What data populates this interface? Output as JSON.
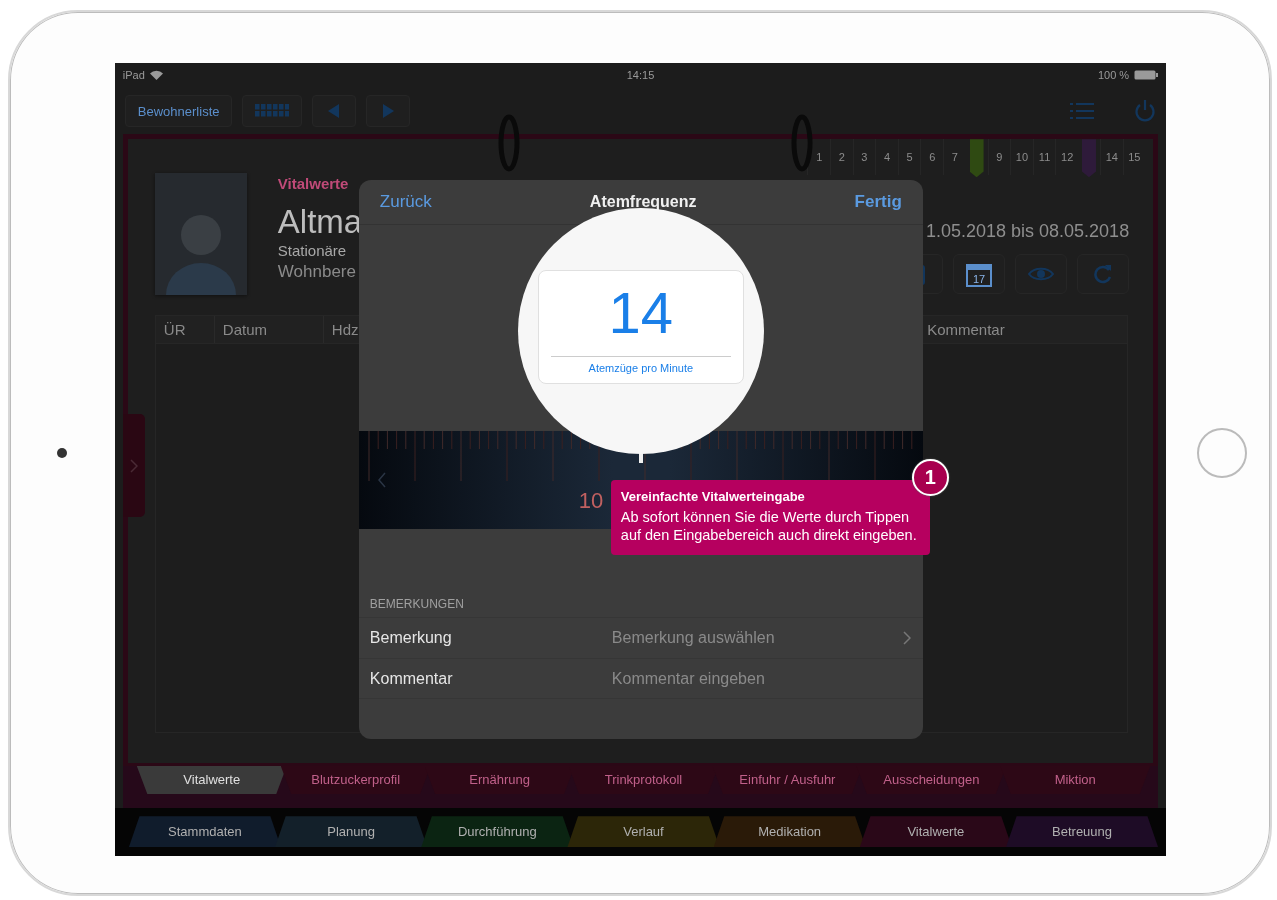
{
  "status_bar": {
    "device": "iPad",
    "time": "14:15",
    "battery": "100 %"
  },
  "toolbar": {
    "left_buttons": [
      {
        "kind": "text",
        "label": "Bewohnerliste"
      },
      {
        "kind": "grid"
      },
      {
        "kind": "prev"
      },
      {
        "kind": "next"
      }
    ],
    "right_buttons": [
      {
        "kind": "list"
      },
      {
        "kind": "power"
      }
    ]
  },
  "day_tabs": [
    {
      "kind": "number",
      "label": "1"
    },
    {
      "kind": "number",
      "label": "2"
    },
    {
      "kind": "number",
      "label": "3"
    },
    {
      "kind": "number",
      "label": "4"
    },
    {
      "kind": "number",
      "label": "5"
    },
    {
      "kind": "number",
      "label": "6"
    },
    {
      "kind": "number",
      "label": "7"
    },
    {
      "kind": "bookmark",
      "color": "#2f4a12"
    },
    {
      "kind": "number",
      "label": "9"
    },
    {
      "kind": "number",
      "label": "10"
    },
    {
      "kind": "number",
      "label": "11"
    },
    {
      "kind": "number",
      "label": "12"
    },
    {
      "kind": "bookmark",
      "color": "#2e1a3a"
    },
    {
      "kind": "number",
      "label": "14"
    },
    {
      "kind": "number",
      "label": "15"
    }
  ],
  "patient": {
    "section": "Vitalwerte",
    "name": "Altma",
    "care_type": "Stationäre",
    "area": "Wohnbere",
    "period": "1.05.2018 bis 08.05.2018"
  },
  "actions": [
    {
      "kind": "clipboard"
    },
    {
      "kind": "calendar",
      "label": "17"
    },
    {
      "kind": "eye"
    },
    {
      "kind": "refresh"
    }
  ],
  "table": {
    "columns": [
      {
        "label": "ÜR"
      },
      {
        "label": "Datum"
      },
      {
        "label": "Hdz"
      },
      {
        "label": "Kommentar"
      }
    ]
  },
  "modal": {
    "back": "Zurück",
    "title": "Atemfrequenz",
    "done": "Fertig",
    "scale_label": "10",
    "level": 0.5,
    "value": "14",
    "unit": "Atemzüge pro Minute",
    "section": "BEMERKUNGEN",
    "rows": [
      {
        "label": "Bemerkung",
        "placeholder": "Bemerkung auswählen",
        "disclosure": true
      },
      {
        "label": "Kommentar",
        "placeholder": "Kommentar eingeben",
        "disclosure": false
      }
    ]
  },
  "tooltip": {
    "step": "1",
    "title": "Vereinfachte Vitalwerteingabe",
    "text": "Ab sofort können Sie die Werte durch Tippen auf den Eingabebereich auch direkt eingeben."
  },
  "sub_tabs": [
    {
      "label": "Vitalwerte",
      "selected": true
    },
    {
      "label": "Blutzuckerprofil",
      "selected": false
    },
    {
      "label": "Ernährung",
      "selected": false
    },
    {
      "label": "Trinkprotokoll",
      "selected": false
    },
    {
      "label": "Einfuhr / Ausfuhr",
      "selected": false
    },
    {
      "label": "Ausscheidungen",
      "selected": false
    },
    {
      "label": "Miktion",
      "selected": false
    }
  ],
  "main_tabs": [
    {
      "label": "Stammdaten",
      "color": "#101c2c"
    },
    {
      "label": "Planung",
      "color": "#13202a"
    },
    {
      "label": "Durchführung",
      "color": "#0b2412"
    },
    {
      "label": "Verlauf",
      "color": "#2c2608"
    },
    {
      "label": "Medikation",
      "color": "#2a1a08"
    },
    {
      "label": "Vitalwerte",
      "color": "#2a0818"
    },
    {
      "label": "Betreuung",
      "color": "#1e0c26"
    }
  ]
}
